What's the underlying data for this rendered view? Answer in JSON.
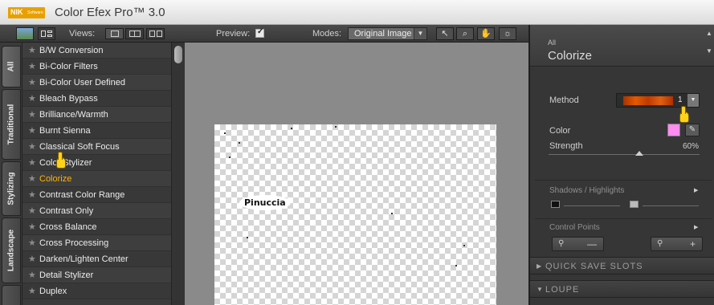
{
  "app": {
    "brand": "NIK Software",
    "title": "Color Efex Pro™ 3.0"
  },
  "toolbar": {
    "views_label": "Views:",
    "preview_label": "Preview:",
    "preview_checked": true,
    "modes_label": "Modes:",
    "mode_value": "Original Image",
    "tools": [
      "pointer-tool",
      "zoom-tool",
      "hand-tool",
      "light-tool"
    ]
  },
  "tabs": [
    "All",
    "Traditional",
    "Stylizing",
    "Landscape"
  ],
  "filters": [
    "B/W Conversion",
    "Bi-Color Filters",
    "Bi-Color User Defined",
    "Bleach Bypass",
    "Brilliance/Warmth",
    "Burnt Sienna",
    "Classical Soft Focus",
    "Color Stylizer",
    "Colorize",
    "Contrast Color Range",
    "Contrast Only",
    "Cross Balance",
    "Cross Processing",
    "Darken/Lighten Center",
    "Detail Stylizer",
    "Duplex"
  ],
  "selected_filter": "Colorize",
  "preview": {
    "overlay_text": "Pinuccia"
  },
  "panel": {
    "category": "All",
    "filter_name": "Colorize",
    "method_label": "Method",
    "method_value": "1",
    "color_label": "Color",
    "color_value": "#ff8cf0",
    "strength_label": "Strength",
    "strength_value": "60%",
    "strength_fraction": 0.6,
    "shadows_highlights": "Shadows / Highlights",
    "control_points": "Control Points",
    "quick_save": "QUICK SAVE SLOTS",
    "loupe": "LOUPE"
  }
}
